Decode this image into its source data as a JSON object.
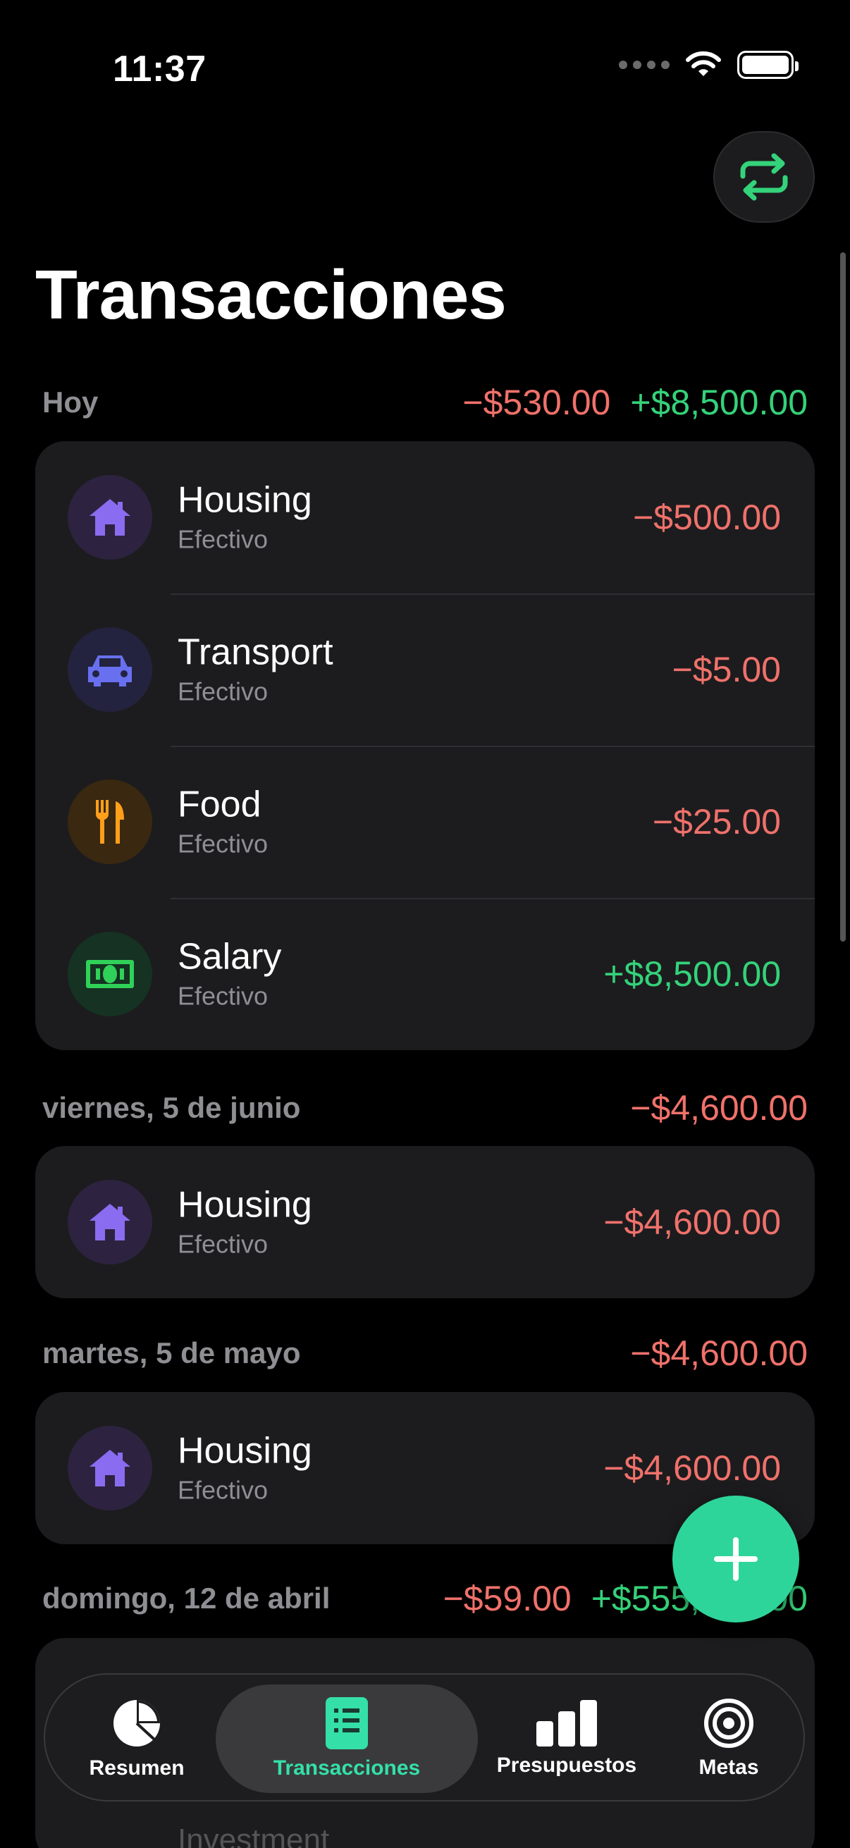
{
  "status_bar": {
    "time": "11:37"
  },
  "page": {
    "title": "Transacciones"
  },
  "colors": {
    "negative": "#f0716b",
    "positive": "#34d27a",
    "accent": "#2ed59b"
  },
  "sections": [
    {
      "label": "Hoy",
      "total_expense": "−$530.00",
      "total_income": "+$8,500.00",
      "rows": [
        {
          "icon": "house-icon",
          "title": "Housing",
          "account": "Efectivo",
          "amount": "−$500.00"
        },
        {
          "icon": "car-icon",
          "title": "Transport",
          "account": "Efectivo",
          "amount": "−$5.00"
        },
        {
          "icon": "fork-knife-icon",
          "title": "Food",
          "account": "Efectivo",
          "amount": "−$25.00"
        },
        {
          "icon": "banknote-icon",
          "title": "Salary",
          "account": "Efectivo",
          "amount": "+$8,500.00"
        }
      ]
    },
    {
      "label": "viernes, 5 de junio",
      "total_expense": "−$4,600.00",
      "rows": [
        {
          "icon": "house-icon",
          "title": "Housing",
          "account": "Efectivo",
          "amount": "−$4,600.00"
        }
      ]
    },
    {
      "label": "martes, 5 de mayo",
      "total_expense": "−$4,600.00",
      "rows": [
        {
          "icon": "house-icon",
          "title": "Housing",
          "account": "Efectivo",
          "amount": "−$4,600.00"
        }
      ]
    },
    {
      "label": "domingo, 12 de abril",
      "total_expense": "−$59.00",
      "total_income": "+$555,555.00"
    }
  ],
  "ghost_row": {
    "title": "Investment"
  },
  "tabs": [
    {
      "label": "Resumen",
      "icon": "pie-chart-icon"
    },
    {
      "label": "Transacciones",
      "icon": "list-icon"
    },
    {
      "label": "Presupuestos",
      "icon": "bar-chart-icon"
    },
    {
      "label": "Metas",
      "icon": "target-icon"
    }
  ]
}
